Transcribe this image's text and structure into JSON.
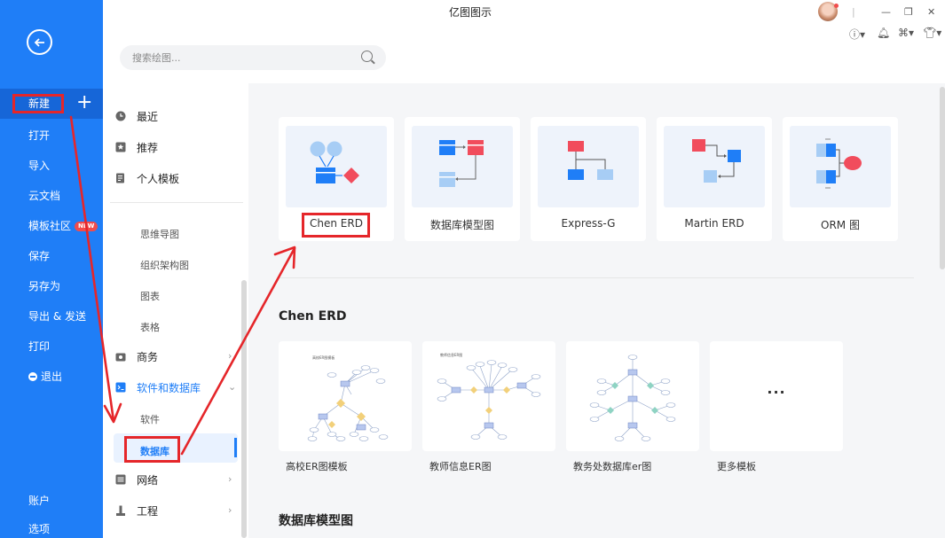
{
  "window": {
    "title": "亿图图示",
    "controls": [
      "minimize-icon",
      "restore-icon",
      "close-icon"
    ]
  },
  "toolbar_icons": [
    "help-icon",
    "bell-icon",
    "apps-icon",
    "shirt-icon"
  ],
  "sidebar": {
    "new_label": "新建",
    "items": [
      "打开",
      "导入",
      "云文档",
      "模板社区",
      "保存",
      "另存为",
      "导出 & 发送",
      "打印",
      "退出"
    ],
    "new_badge": "NEW",
    "bottom": [
      "账户",
      "选项"
    ]
  },
  "search": {
    "placeholder": "搜索绘图..."
  },
  "categories": {
    "top": [
      "最近",
      "推荐",
      "个人模板"
    ],
    "subs": [
      "思维导图",
      "组织架构图",
      "图表",
      "表格"
    ],
    "business": "商务",
    "software": "软件和数据库",
    "software_subs": [
      "软件",
      "数据库"
    ],
    "network": "网络",
    "engineering": "工程"
  },
  "templates": [
    {
      "label": "Chen ERD"
    },
    {
      "label": "数据库模型图"
    },
    {
      "label": "Express-G"
    },
    {
      "label": "Martin ERD"
    },
    {
      "label": "ORM 图"
    }
  ],
  "sections": {
    "chen_title": "Chen ERD",
    "dbmodel_title": "数据库模型图"
  },
  "examples": [
    {
      "label": "高校ER图模板",
      "thumb_title": "高校ER图模板"
    },
    {
      "label": "教师信息ER图",
      "thumb_title": "教师信息ER图"
    },
    {
      "label": "教务处数据库er图",
      "thumb_title": ""
    },
    {
      "label": "更多模板",
      "more": "···"
    }
  ],
  "colors": {
    "brand_blue": "#1f7ef7",
    "annotation_red": "#e5262a",
    "entity_blue": "#1f7ef7",
    "relation_red": "#f14c5c"
  }
}
